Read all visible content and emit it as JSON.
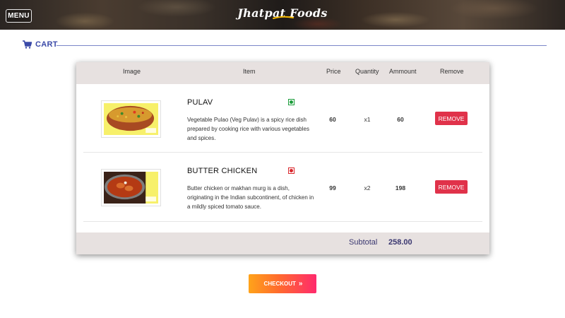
{
  "header": {
    "menu_label": "MENU",
    "brand": "Jhatpat Foods"
  },
  "cart": {
    "title": "CART",
    "accent_color": "#3b4aa8",
    "columns": [
      "Image",
      "Item",
      "Price",
      "Quantity",
      "Ammount",
      "Remove"
    ],
    "items": [
      {
        "name": "PULAV",
        "veg_indicator": "veg",
        "indicator_color": "#1a9c3a",
        "image_icon": "pulav-dish-image",
        "description": "Vegetable Pulao (Veg Pulav) is a spicy rice dish prepared by cooking rice with various vegetables and spices.",
        "price": "60",
        "quantity": "x1",
        "amount": "60",
        "remove_label": "REMOVE"
      },
      {
        "name": "BUTTER CHICKEN",
        "veg_indicator": "non-veg",
        "indicator_color": "#d9262c",
        "image_icon": "butter-chicken-dish-image",
        "description": "Butter chicken or makhan murg is a dish, originating in the Indian subcontinent, of chicken in a mildly spiced tomato sauce.",
        "price": "99",
        "quantity": "x2",
        "amount": "198",
        "remove_label": "REMOVE"
      }
    ],
    "subtotal_label": "Subtotal",
    "subtotal_value": "258.00",
    "remove_color": "#e0324a"
  },
  "checkout": {
    "label": "CHECKOUT",
    "arrows": "»"
  }
}
